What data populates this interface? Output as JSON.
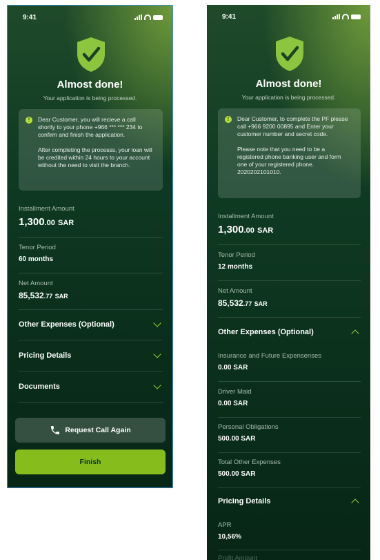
{
  "status_bar": {
    "time": "9:41"
  },
  "screen_a": {
    "title": "Almost done!",
    "subtitle": "Your application is being processed.",
    "notice": {
      "p1": "Dear Customer, you will recieve a call shortly to your phone +966 *** *** 234 to confirm and finish the application.",
      "p2": "After completing the processs, your loan will be credited within 24 hours to your account without the need to visit the branch."
    },
    "installment": {
      "label": "Installment Amount",
      "whole": "1,300",
      "decimal": ".00",
      "currency": "SAR"
    },
    "tenor": {
      "label": "Tenor Period",
      "value": "60 months"
    },
    "net": {
      "label": "Net Amount",
      "whole": "85,532",
      "decimal": ".77",
      "currency": "SAR"
    },
    "sections": [
      "Other Expenses (Optional)",
      "Pricing Details",
      "Documents"
    ],
    "request_call_label": "Request Call Again",
    "finish_label": "Finish"
  },
  "screen_b": {
    "title": "Almost done!",
    "subtitle": "Your application is being processed.",
    "notice": {
      "p1": "Dear Customer, to complete the PF please call +966 9200 00895 and Enter your customer number and secret code.",
      "p2": "Please note that you need to be a registered phone banking user and form one of your registered phone. 2020202101010."
    },
    "installment": {
      "label": "Installment Amount",
      "whole": "1,300",
      "decimal": ".00",
      "currency": "SAR"
    },
    "tenor": {
      "label": "Tenor Period",
      "value": "12 months"
    },
    "net": {
      "label": "Net Amount",
      "whole": "85,532",
      "decimal": ".77",
      "currency": "SAR"
    },
    "other_expenses_title": "Other Expenses (Optional)",
    "expenses": [
      {
        "label": "Insurance and Future Expensenses",
        "value": "0.00 SAR"
      },
      {
        "label": "Driver Maid",
        "value": "0.00 SAR"
      },
      {
        "label": "Personal Obligations",
        "value": "500.00 SAR"
      },
      {
        "label": "Total Other Expenses",
        "value": "500.00 SAR"
      }
    ],
    "pricing_title": "Pricing Details",
    "apr": {
      "label": "APR",
      "value": "10,56%"
    },
    "profit_label": "Profit Amount"
  },
  "colors": {
    "accent": "#9fd33a",
    "finish_button": "#86bd1d",
    "selection_border": "#3a8fd8"
  }
}
